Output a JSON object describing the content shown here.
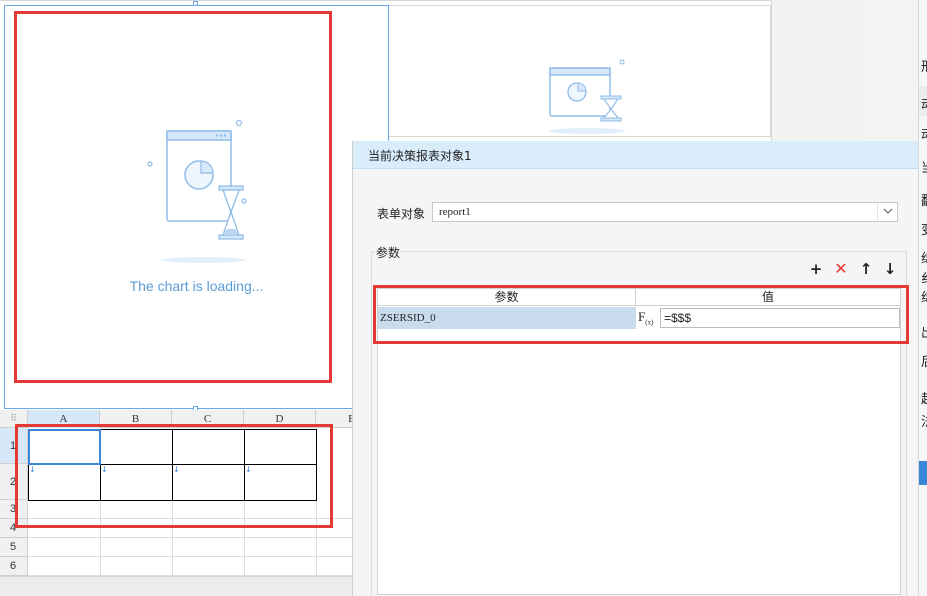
{
  "chart": {
    "loading_text": "The chart is loading..."
  },
  "sheet": {
    "columns": [
      "A",
      "B",
      "C",
      "D",
      "E"
    ],
    "rows": [
      "1",
      "2",
      "3",
      "4",
      "5",
      "6"
    ]
  },
  "panel": {
    "title": "当前决策报表对象1",
    "form_label": "表单对象",
    "form_value": "report1",
    "params_group_label": "参数",
    "add_symbol": "+",
    "delete_symbol": "✕",
    "move_up_symbol": "↑",
    "move_down_symbol": "↓",
    "table": {
      "col_param": "参数",
      "col_value": "值",
      "rows": [
        {
          "param": "ZSERSID_0",
          "fx": "F",
          "fx_sub": "(x)",
          "value": "=$$$"
        }
      ]
    }
  },
  "property_panel": {
    "labels": [
      "刑",
      "动",
      "动",
      "当",
      "翻",
      "变",
      "绵",
      "纟",
      "绵",
      "出",
      "后",
      "起",
      "法"
    ]
  },
  "colors": {
    "accent": "#3a86d9",
    "highlight_border": "#e53935",
    "panel_header": "#d9ecfa",
    "selected_row": "#c9dced"
  },
  "icons": {
    "chart_placeholder": "window-pie-hourglass-icon",
    "dropdown": "chevron-down-icon"
  }
}
